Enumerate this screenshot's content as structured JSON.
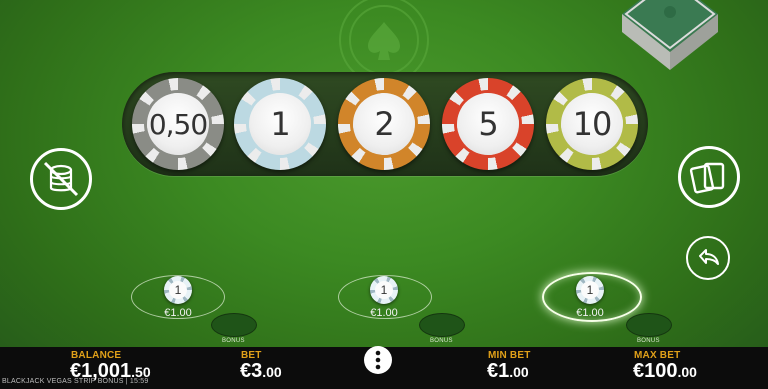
{
  "tray": {
    "chips": [
      {
        "label": "0,50",
        "color": "#8a8c86"
      },
      {
        "label": "1",
        "color": "#bcd9e2"
      },
      {
        "label": "2",
        "color": "#d1852a"
      },
      {
        "label": "5",
        "color": "#d9432a"
      },
      {
        "label": "10",
        "color": "#b1bb47"
      }
    ]
  },
  "spots": [
    {
      "chip": "1",
      "amount": "€1.00"
    },
    {
      "chip": "1",
      "amount": "€1.00"
    },
    {
      "chip": "1",
      "amount": "€1.00"
    }
  ],
  "bonus_label": "BONUS",
  "bar": {
    "balance_label": "BALANCE",
    "balance_value": "€1,001",
    "balance_cents": ".50",
    "bet_label": "BET",
    "bet_value": "€3",
    "bet_cents": ".00",
    "min_label": "MIN BET",
    "min_value": "€1",
    "min_cents": ".00",
    "max_label": "MAX BET",
    "max_value": "€100",
    "max_cents": ".00"
  },
  "footer": "BLACKJACK VEGAS STRIP BONUS | 15:59",
  "icons": {
    "clear_bets": "no-chips-icon",
    "deal": "cards-icon",
    "undo": "undo-arrow-icon",
    "menu": "vertical-dots-icon"
  }
}
